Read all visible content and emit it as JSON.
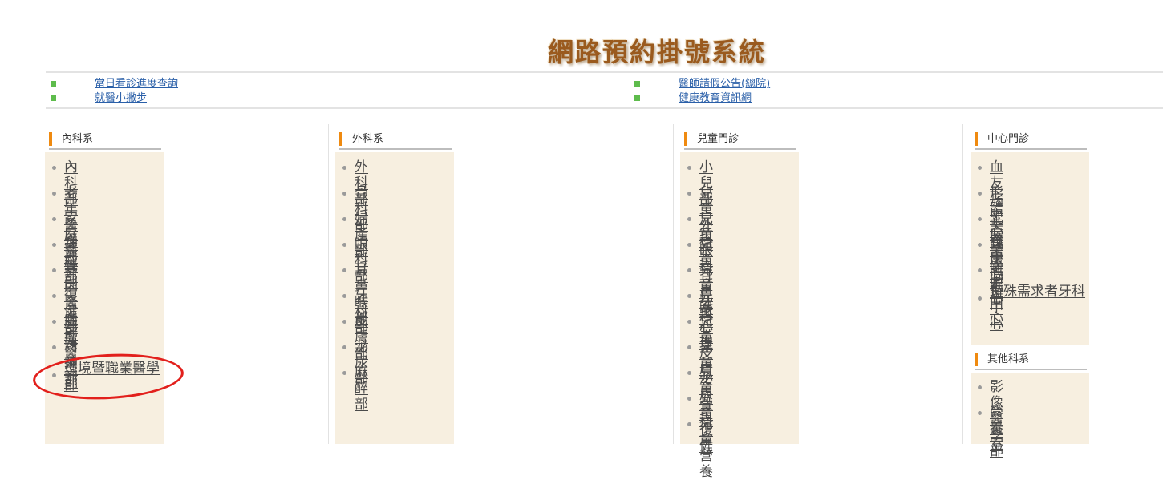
{
  "title": "網路預約掛號系統",
  "top_links": [
    {
      "label": "當日看診進度查詢"
    },
    {
      "label": "醫師請假公告(總院)"
    },
    {
      "label": "就醫小撇步"
    },
    {
      "label": "健康教育資訊網"
    }
  ],
  "sections": {
    "internal": {
      "heading": "內科系",
      "items": [
        "內科部",
        "老年醫學部",
        "家庭醫學部",
        "神經部",
        "基因醫學部",
        "復健部",
        "腫瘤醫學部",
        "精神部",
        "環境暨職業醫學部"
      ]
    },
    "surgical": {
      "heading": "外科系",
      "items": [
        "外科部",
        "骨科部",
        "婦產部",
        "眼科部",
        "耳鼻喉部",
        "牙科部",
        "皮膚部",
        "泌尿部",
        "麻醉部"
      ]
    },
    "pediatric": {
      "heading": "兒童門診",
      "items": [
        "小兒部",
        "兒童外科",
        "兒童眼科",
        "兒童耳鼻喉",
        "兒童牙科",
        "兒童心理",
        "兒童皮膚",
        "兒童泌尿",
        "兒童骨科",
        "兒童復健",
        "兒童營養"
      ]
    },
    "centers": {
      "heading": "中心門診",
      "items": [
        "血友病中心",
        "形體美容中心",
        "乳房醫學中心",
        "臨床心理中心",
        "睡眠中心",
        "特殊需求者牙科"
      ]
    },
    "others": {
      "heading": "其他科系",
      "items": [
        "影像醫學部",
        "營養室"
      ]
    }
  },
  "colors": {
    "accent": "#ef8a10",
    "bullet": "#5ebc4c",
    "link": "#2a5fa8",
    "panel": "#f7efe0",
    "annotation": "#e2201c"
  }
}
